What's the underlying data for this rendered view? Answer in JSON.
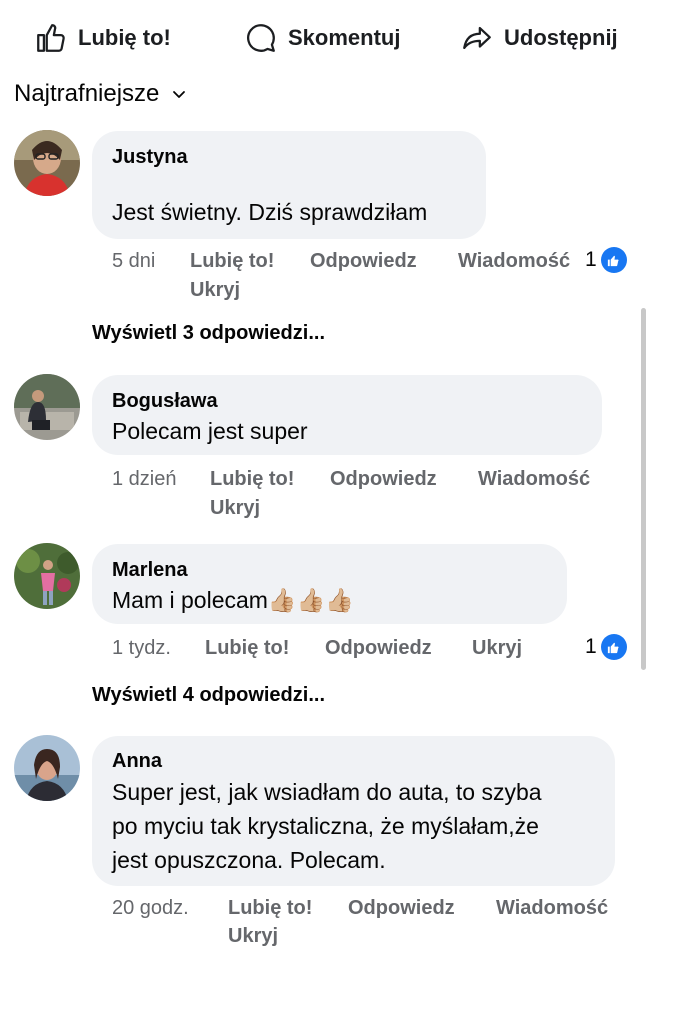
{
  "actions": {
    "like": "Lubię to!",
    "comment": "Skomentuj",
    "share": "Udostępnij"
  },
  "sort": {
    "label": "Najtrafniejsze"
  },
  "colors": {
    "bubble": "#f0f2f5",
    "like_blue": "#1877f2",
    "meta_gray": "#65676b"
  },
  "comments": [
    {
      "author": "Justyna",
      "text": "Jest świetny. Dziś sprawdziłam",
      "time": "5 dni",
      "like": "Lubię to!",
      "reply": "Odpowiedz",
      "message": "Wiadomość",
      "hide": "Ukryj",
      "likes": "1"
    },
    {
      "author": "Bogusława",
      "text": "Polecam jest super",
      "time": "1 dzień",
      "like": "Lubię to!",
      "reply": "Odpowiedz",
      "message": "Wiadomość",
      "hide": "Ukryj"
    },
    {
      "author": "Marlena",
      "text": "Mam i polecam👍🏼👍🏼👍🏼",
      "time": "1 tydz.",
      "like": "Lubię to!",
      "reply": "Odpowiedz",
      "hide": "Ukryj",
      "likes": "1"
    },
    {
      "author": "Anna",
      "text_lines": [
        "Super jest, jak wsiadłam do auta, to szyba",
        "po myciu  tak krystaliczna, że myślałam,że",
        "jest opuszczona. Polecam."
      ],
      "time": "20 godz.",
      "like": "Lubię to!",
      "reply": "Odpowiedz",
      "message": "Wiadomość",
      "hide": "Ukryj"
    }
  ],
  "view_replies": [
    "Wyświetl 3 odpowiedzi...",
    "Wyświetl 4 odpowiedzi..."
  ]
}
